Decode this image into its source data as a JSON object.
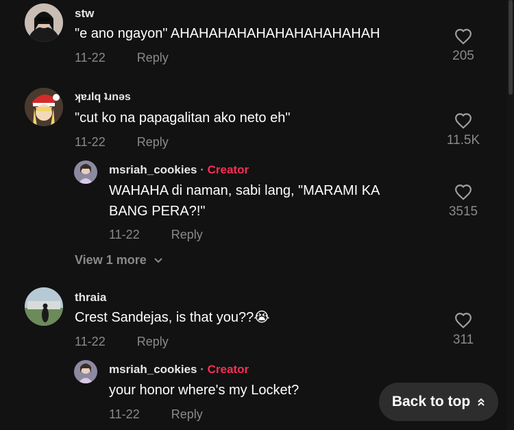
{
  "comments": [
    {
      "username": "stw",
      "text": "\"e ano ngayon\" AHAHAHAHAHAHAHAHAHAHAH",
      "date": "11-22",
      "reply_label": "Reply",
      "likes": "205"
    },
    {
      "username": "ʞɐɹlq ʇɹnǝs",
      "text": "\"cut ko na papagalitan ako neto eh\"",
      "date": "11-22",
      "reply_label": "Reply",
      "likes": "11.5K",
      "replies": [
        {
          "username": "msriah_cookies",
          "separator": "·",
          "badge": "Creator",
          "text_line1": "WAHAHA di naman, sabi lang, \"MARAMI KA",
          "text_line2": "BANG PERA?!\"",
          "date": "11-22",
          "reply_label": "Reply",
          "likes": "3515"
        }
      ],
      "view_more": "View 1 more"
    },
    {
      "username": "thraia",
      "text": "Crest Sandejas, is that you??",
      "emoji": "😭",
      "date": "11-22",
      "reply_label": "Reply",
      "likes": "311",
      "replies": [
        {
          "username": "msriah_cookies",
          "separator": "·",
          "badge": "Creator",
          "text_line1": "your honor where's my Locket?",
          "date": "11-22",
          "reply_label": "Reply"
        }
      ]
    }
  ],
  "back_to_top": "Back to top",
  "colors": {
    "background": "#121212",
    "creator": "#fe2c55",
    "muted": "#8a8a8a"
  }
}
